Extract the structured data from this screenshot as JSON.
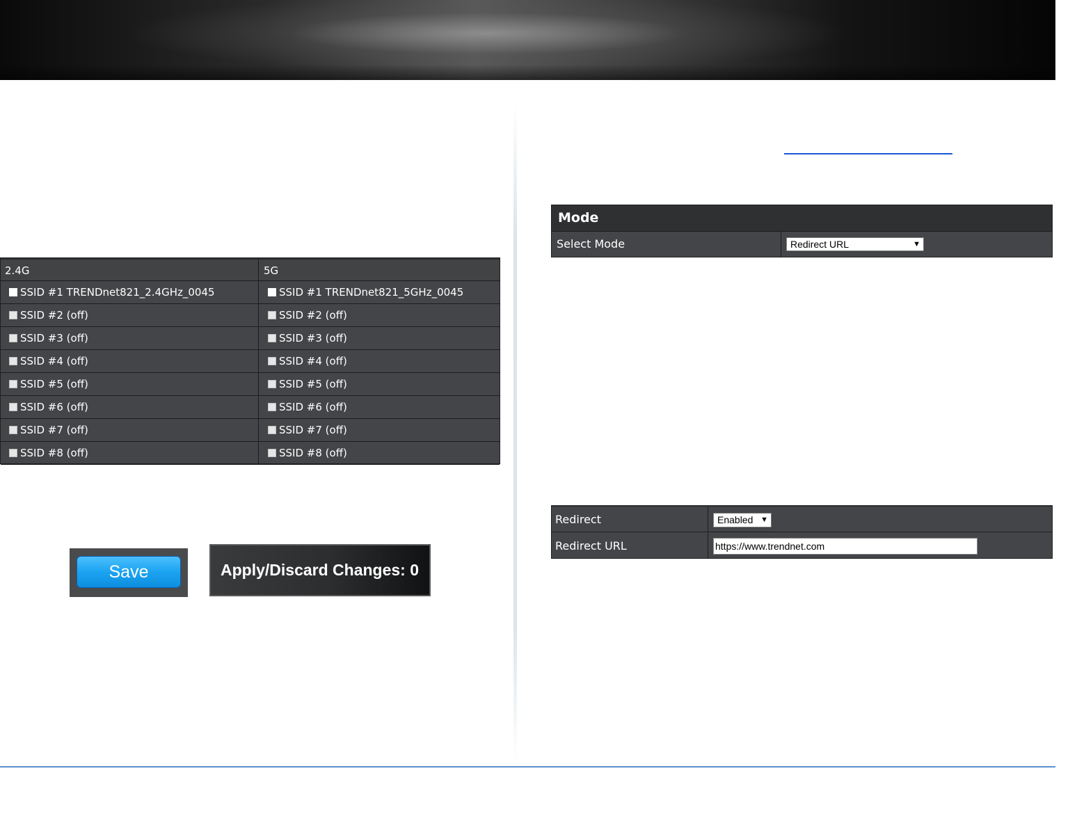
{
  "ssid_table": {
    "headers": [
      "2.4G",
      "5G"
    ],
    "rows": [
      [
        {
          "label": "SSID #1 TRENDnet821_2.4GHz_0045",
          "checked": false
        },
        {
          "label": "SSID #1 TRENDnet821_5GHz_0045",
          "checked": false
        }
      ],
      [
        {
          "label": "SSID #2 (off)",
          "checked": false
        },
        {
          "label": "SSID #2 (off)",
          "checked": false
        }
      ],
      [
        {
          "label": "SSID #3 (off)",
          "checked": false
        },
        {
          "label": "SSID #3 (off)",
          "checked": false
        }
      ],
      [
        {
          "label": "SSID #4 (off)",
          "checked": false
        },
        {
          "label": "SSID #4 (off)",
          "checked": false
        }
      ],
      [
        {
          "label": "SSID #5 (off)",
          "checked": false
        },
        {
          "label": "SSID #5 (off)",
          "checked": false
        }
      ],
      [
        {
          "label": "SSID #6 (off)",
          "checked": false
        },
        {
          "label": "SSID #6 (off)",
          "checked": false
        }
      ],
      [
        {
          "label": "SSID #7 (off)",
          "checked": false
        },
        {
          "label": "SSID #7 (off)",
          "checked": false
        }
      ],
      [
        {
          "label": "SSID #8 (off)",
          "checked": false
        },
        {
          "label": "SSID #8 (off)",
          "checked": false
        }
      ]
    ]
  },
  "buttons": {
    "save_label": "Save",
    "apply_label": "Apply/Discard Changes: 0"
  },
  "mode_table": {
    "title": "Mode",
    "select_mode_label": "Select Mode",
    "select_mode_value": "Redirect URL"
  },
  "redirect_table": {
    "redirect_label": "Redirect",
    "redirect_value": "Enabled",
    "redirect_url_label": "Redirect URL",
    "redirect_url_value": "https://www.trendnet.com"
  },
  "icons": {
    "caret": "▼"
  },
  "colors": {
    "table_bg": "#434548",
    "save_blue": "#1ba3f0",
    "link_blue": "#1a56d6",
    "footer_rule": "#5b8fd0"
  }
}
